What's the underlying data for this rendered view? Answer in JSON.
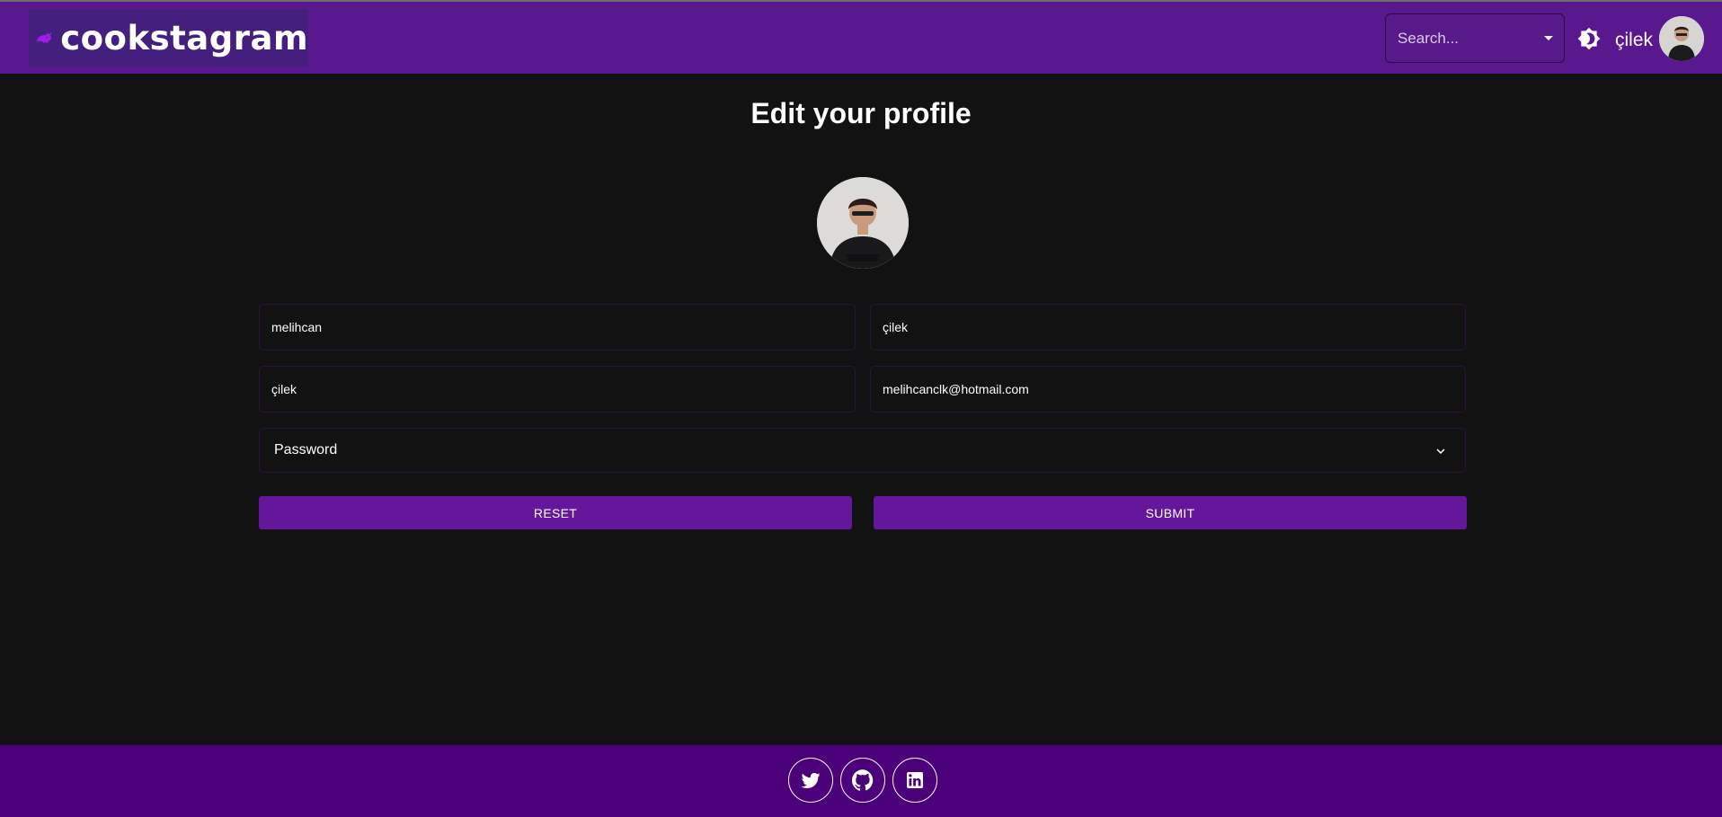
{
  "header": {
    "logo_text": "cookstagram",
    "search_placeholder": "Search...",
    "username": "çilek",
    "theme_icon": "brightness-icon"
  },
  "main": {
    "title": "Edit your profile",
    "fields": {
      "first_name": "melihcan",
      "last_name": "çilek",
      "username": "çilek",
      "email": "melihcanclk@hotmail.com"
    },
    "password_label": "Password",
    "reset_label": "RESET",
    "submit_label": "SUBMIT"
  },
  "footer": {
    "icons": [
      "twitter-icon",
      "github-icon",
      "linkedin-icon"
    ]
  },
  "colors": {
    "navbar": "#5a188e",
    "background": "#121212",
    "button": "#64179a",
    "footer": "#4a0179"
  }
}
